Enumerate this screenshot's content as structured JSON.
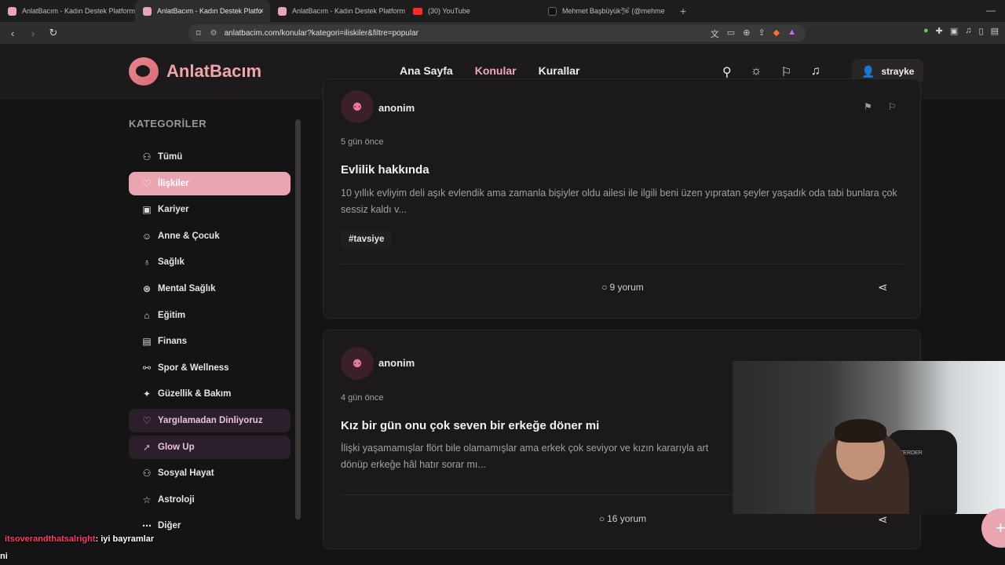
{
  "browser": {
    "tabs": [
      {
        "label": "AnlatBacım - Kadın Destek Platformu",
        "active": false
      },
      {
        "label": "AnlatBacım - Kadın Destek Platfo",
        "active": true
      },
      {
        "label": "AnlatBacım - Kadın Destek Platformu",
        "active": false
      },
      {
        "label": "(30) YouTube",
        "active": false
      },
      {
        "label": "Mehmet Başbüyük🛩 (@mehme",
        "active": false
      }
    ],
    "close_glyph": "×",
    "new_tab_glyph": "+",
    "window_controls": "—",
    "url": "anlatbacim.com/konular?kategori=iliskiler&filtre=popular"
  },
  "header": {
    "logo_text": "AnlatBacım",
    "nav": [
      {
        "label": "Ana Sayfa",
        "active": false
      },
      {
        "label": "Konular",
        "active": true
      },
      {
        "label": "Kurallar",
        "active": false
      }
    ],
    "username": "strayke"
  },
  "sidebar": {
    "title": "KATEGORİLER",
    "items": [
      {
        "label": "Tümü",
        "icon": "users-icon",
        "style": "normal"
      },
      {
        "label": "İlişkiler",
        "icon": "heart-icon",
        "style": "active"
      },
      {
        "label": "Kariyer",
        "icon": "briefcase-icon",
        "style": "normal"
      },
      {
        "label": "Anne & Çocuk",
        "icon": "baby-icon",
        "style": "normal"
      },
      {
        "label": "Sağlık",
        "icon": "stethoscope-icon",
        "style": "normal"
      },
      {
        "label": "Mental Sağlık",
        "icon": "brain-icon",
        "style": "normal"
      },
      {
        "label": "Eğitim",
        "icon": "graduation-cap-icon",
        "style": "normal"
      },
      {
        "label": "Finans",
        "icon": "wallet-icon",
        "style": "normal"
      },
      {
        "label": "Spor & Wellness",
        "icon": "dumbbell-icon",
        "style": "normal"
      },
      {
        "label": "Güzellik & Bakım",
        "icon": "sparkles-icon",
        "style": "normal"
      },
      {
        "label": "Yargılamadan Dinliyoruz",
        "icon": "heart-handshake-icon",
        "style": "purple"
      },
      {
        "label": "Glow Up",
        "icon": "rocket-icon",
        "style": "purple"
      },
      {
        "label": "Sosyal Hayat",
        "icon": "users-icon",
        "style": "normal"
      },
      {
        "label": "Astroloji",
        "icon": "star-icon",
        "style": "normal"
      },
      {
        "label": "Diğer",
        "icon": "more-icon",
        "style": "normal"
      }
    ]
  },
  "posts": [
    {
      "author": "anonim",
      "time": "5 gün önce",
      "title": "Evlilik hakkında",
      "excerpt": "10 yıllık evliyim deli aşık evlendik ama zamanla bişiyler oldu ailesi ile ilgili beni üzen yıpratan şeyler yaşadık oda tabi bunlara çok sessiz kaldı v...",
      "tag": "#tavsiye",
      "comments": "9 yorum"
    },
    {
      "author": "anonim",
      "time": "4 gün önce",
      "title": "Kız bir gün onu çok seven bir erkeğe döner mi",
      "excerpt": "İlişki yaşamamışlar flört bile olamamışlar ama erkek çok seviyor ve kızın kararıyla art dönüp erkeğe hâl hatır sorar mı...",
      "comments": "16 yorum"
    }
  ],
  "overlay": {
    "chat_user": "itsoverandthatsalright",
    "chat_message": ": iyi bayramlar",
    "chat_fragment": "ni",
    "webcam_chair_text": "TERDER"
  },
  "fab_label": "+"
}
